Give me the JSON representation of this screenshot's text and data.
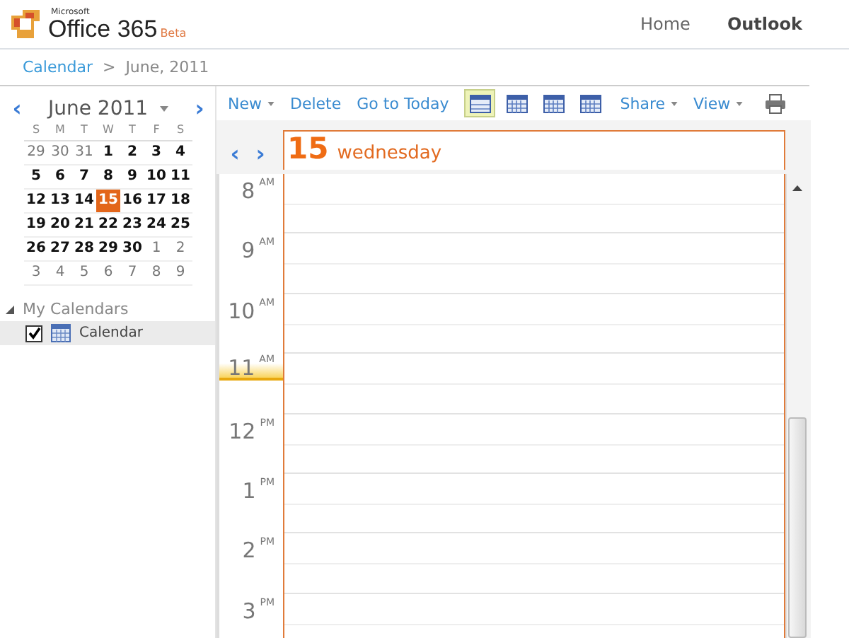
{
  "header": {
    "brand_small": "Microsoft",
    "brand": "Office 365",
    "brand_tag": "Beta",
    "nav": [
      {
        "label": "Home",
        "selected": false
      },
      {
        "label": "Outlook",
        "selected": true
      }
    ]
  },
  "breadcrumb": {
    "link": "Calendar",
    "separator": ">",
    "current": "June, 2011"
  },
  "mini_calendar": {
    "prev": "‹",
    "title": "June 2011",
    "next": "›",
    "weekdays": [
      "S",
      "M",
      "T",
      "W",
      "T",
      "F",
      "S"
    ],
    "weeks": [
      [
        {
          "day": "29",
          "in_month": false,
          "selected": false
        },
        {
          "day": "30",
          "in_month": false,
          "selected": false
        },
        {
          "day": "31",
          "in_month": false,
          "selected": false
        },
        {
          "day": "1",
          "in_month": true,
          "selected": false
        },
        {
          "day": "2",
          "in_month": true,
          "selected": false
        },
        {
          "day": "3",
          "in_month": true,
          "selected": false
        },
        {
          "day": "4",
          "in_month": true,
          "selected": false
        }
      ],
      [
        {
          "day": "5",
          "in_month": true,
          "selected": false
        },
        {
          "day": "6",
          "in_month": true,
          "selected": false
        },
        {
          "day": "7",
          "in_month": true,
          "selected": false
        },
        {
          "day": "8",
          "in_month": true,
          "selected": false
        },
        {
          "day": "9",
          "in_month": true,
          "selected": false
        },
        {
          "day": "10",
          "in_month": true,
          "selected": false
        },
        {
          "day": "11",
          "in_month": true,
          "selected": false
        }
      ],
      [
        {
          "day": "12",
          "in_month": true,
          "selected": false
        },
        {
          "day": "13",
          "in_month": true,
          "selected": false
        },
        {
          "day": "14",
          "in_month": true,
          "selected": false
        },
        {
          "day": "15",
          "in_month": true,
          "selected": true
        },
        {
          "day": "16",
          "in_month": true,
          "selected": false
        },
        {
          "day": "17",
          "in_month": true,
          "selected": false
        },
        {
          "day": "18",
          "in_month": true,
          "selected": false
        }
      ],
      [
        {
          "day": "19",
          "in_month": true,
          "selected": false
        },
        {
          "day": "20",
          "in_month": true,
          "selected": false
        },
        {
          "day": "21",
          "in_month": true,
          "selected": false
        },
        {
          "day": "22",
          "in_month": true,
          "selected": false
        },
        {
          "day": "23",
          "in_month": true,
          "selected": false
        },
        {
          "day": "24",
          "in_month": true,
          "selected": false
        },
        {
          "day": "25",
          "in_month": true,
          "selected": false
        }
      ],
      [
        {
          "day": "26",
          "in_month": true,
          "selected": false
        },
        {
          "day": "27",
          "in_month": true,
          "selected": false
        },
        {
          "day": "28",
          "in_month": true,
          "selected": false
        },
        {
          "day": "29",
          "in_month": true,
          "selected": false
        },
        {
          "day": "30",
          "in_month": true,
          "selected": false
        },
        {
          "day": "1",
          "in_month": false,
          "selected": false
        },
        {
          "day": "2",
          "in_month": false,
          "selected": false
        }
      ],
      [
        {
          "day": "3",
          "in_month": false,
          "selected": false
        },
        {
          "day": "4",
          "in_month": false,
          "selected": false
        },
        {
          "day": "5",
          "in_month": false,
          "selected": false
        },
        {
          "day": "6",
          "in_month": false,
          "selected": false
        },
        {
          "day": "7",
          "in_month": false,
          "selected": false
        },
        {
          "day": "8",
          "in_month": false,
          "selected": false
        },
        {
          "day": "9",
          "in_month": false,
          "selected": false
        }
      ]
    ]
  },
  "calendars": {
    "title": "My Calendars",
    "expanded": true,
    "items": [
      {
        "label": "Calendar",
        "checked": true,
        "selected": true
      }
    ]
  },
  "toolbar": [
    {
      "label": "New",
      "kind": "menu"
    },
    {
      "label": "Delete",
      "kind": "button"
    },
    {
      "label": "Go to Today",
      "kind": "button"
    }
  ],
  "view_buttons": [
    {
      "selected": true
    },
    {
      "selected": false
    },
    {
      "selected": false
    },
    {
      "selected": false
    }
  ],
  "toolbar_menus": [
    {
      "label": "Share"
    },
    {
      "label": "View"
    }
  ],
  "day_header": {
    "prev": "‹",
    "next": "›",
    "day": "15",
    "weekday": "wednesday"
  },
  "hours": [
    {
      "hour": "8",
      "period": "AM",
      "current": false
    },
    {
      "hour": "9",
      "period": "AM",
      "current": false
    },
    {
      "hour": "10",
      "period": "AM",
      "current": false
    },
    {
      "hour": "11",
      "period": "AM",
      "current": true
    },
    {
      "hour": "12",
      "period": "PM",
      "current": false
    },
    {
      "hour": "1",
      "period": "PM",
      "current": false
    },
    {
      "hour": "2",
      "period": "PM",
      "current": false
    },
    {
      "hour": "3",
      "period": "PM",
      "current": false
    }
  ]
}
